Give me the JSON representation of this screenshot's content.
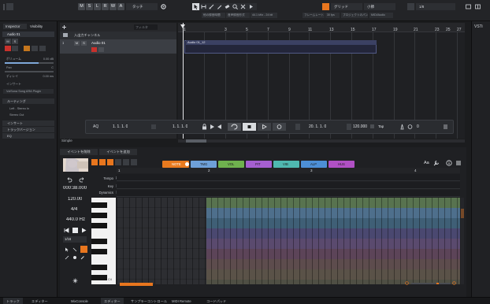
{
  "toolbar": {
    "mode_buttons": [
      "M",
      "S",
      "L",
      "R",
      "W",
      "A"
    ],
    "grid_label": "タッチ",
    "snap_label": "グリッド",
    "quantize_label": "小節",
    "quantize_value": "1/8",
    "status": [
      "他の録音時間",
      "音声録音形式",
      "44.1 kHz - 24 bit",
      "フレームレート",
      "30 fps",
      "プロジェクトのパン",
      "MIDI/Audio"
    ]
  },
  "inspector": {
    "tab_inspector": "Inspector",
    "tab_visibility": "Visibility",
    "track_name": "Audio 01",
    "volume_label": "ボリューム",
    "volume_value": "0.00 dB",
    "pan_label": "Pan",
    "pan_value": "C",
    "delay_label": "ディレイ",
    "delay_value": "0.00 ms",
    "routing_label": "ルーティング",
    "input_label": "Left - Stereo In",
    "output_label": "Stereo Out",
    "insert_label": "インサート",
    "vocaloid_label": "VoiSona Song ARA Plugin",
    "section_routing": "ルーティング",
    "section_inserts": "インサート",
    "section_track_version": "トラックバージョン",
    "section_eq": "EQ"
  },
  "tracklist": {
    "folder_label": "入出力チャンネル",
    "track_number": "1",
    "track_name": "Audio 01",
    "search_placeholder": "フィルタ"
  },
  "arranger": {
    "ruler": [
      "1",
      "3",
      "5",
      "7",
      "9",
      "11",
      "13",
      "15",
      "17",
      "19",
      "21",
      "23",
      "25",
      "27"
    ],
    "clip_name": "Audio 01_12"
  },
  "transport": {
    "left_locator": "1. 1. 1. 0",
    "right_locator": "1. 1. 1. 0",
    "position": "20. 1. 1. 0",
    "tempo": "120.000",
    "signature": "Tap"
  },
  "project_label": "Simple",
  "right_panel": {
    "title": "VSTi"
  },
  "lower_zone": {
    "add_track_label": "イベントを削除",
    "add_event_label": "イベントを追加",
    "param_tabs": [
      "NOTE",
      "TMG",
      "VOL",
      "PIT",
      "VIB",
      "ALP",
      "HUS"
    ],
    "time_display": "000:38.000",
    "tempo_row": "Tempo",
    "tempo_value": "120.0",
    "key_row": "Key",
    "key_value": "C",
    "dynamics_row": "Dynamics",
    "dynamics_value": "N",
    "tempo_display": "120.00",
    "signature_display": "4/4",
    "frequency_display": "440.0 Hz",
    "quantize_display": "1/16",
    "ruler": [
      "1",
      "2",
      "3",
      "4"
    ],
    "octave_label": "C4",
    "right_controls": "Aa"
  },
  "bottom_tabs": [
    "トラック",
    "エディター",
    "MixConsole",
    "エディター",
    "サンプラーコントロール",
    "MIDI Remote",
    "コードパッド"
  ],
  "colors": {
    "accent_orange": "#e8761e",
    "record_red": "#c8312c",
    "note_tab": "#e87a1f",
    "tmg_tab": "#6ea0d8",
    "vol_tab": "#6fb14e",
    "pit_tab": "#a55fd0",
    "vib_tab": "#4fb8b0",
    "alp_tab": "#4d8fd6",
    "hus_tab": "#b050c4"
  }
}
